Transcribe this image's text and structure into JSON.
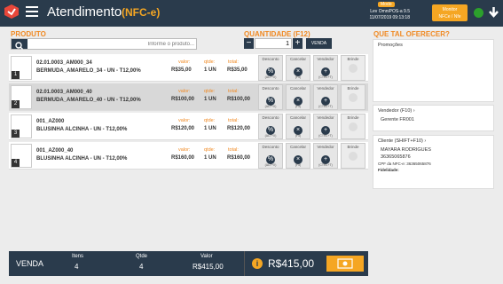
{
  "header": {
    "title": "Atendimento",
    "subtitle": "(NFC-e)",
    "mode_badge": "Modo",
    "device_line1": "Lev OmniPOS-a 9.5",
    "device_line2": "11/07/2019 09:13:18",
    "monitor_label_1": "Monitor",
    "monitor_label_2": "NFCe / Nfe"
  },
  "product": {
    "label": "PRODUTO",
    "placeholder": "Informe o produto..."
  },
  "quantity": {
    "label": "QUANTIDADE (F12)",
    "value": "1",
    "sell_label": "VENDA"
  },
  "suggest_label": "QUE TAL OFERECER?",
  "items": [
    {
      "num": "1",
      "code": "02.01.0003_AM000_34",
      "desc": "BERMUDA_AMARELO_34 - UN - T12,00%",
      "valor": "R$35,00",
      "qtde": "1 UN",
      "total": "R$35,00"
    },
    {
      "num": "2",
      "code": "02.01.0003_AM000_40",
      "desc": "BERMUDA_AMARELO_40 - UN - T12,00%",
      "valor": "R$100,00",
      "qtde": "1 UN",
      "total": "R$100,00"
    },
    {
      "num": "3",
      "code": "001_AZ000",
      "desc": "BLUSINHA ALCINHA - UN - T12,00%",
      "valor": "R$120,00",
      "qtde": "1 UN",
      "total": "R$120,00"
    },
    {
      "num": "4",
      "code": "001_AZ000_40",
      "desc": "BLUSINHA ALCINHA - UN - T12,00%",
      "valor": "R$160,00",
      "qtde": "1 UN",
      "total": "R$160,00"
    }
  ],
  "item_labels": {
    "valor": "valor:",
    "qtde": "qtde:",
    "total": "total:"
  },
  "actions": {
    "desconto": "Desconto",
    "desconto_key": "(ALT+X)",
    "cancelar": "Cancelar",
    "cancelar_key": "(F5)",
    "vendedor": "Vendedor",
    "vendedor_key": "(CTRL+T)",
    "brinde": "Brinde"
  },
  "panels": {
    "promocoes": "Promoções",
    "vendedor_title": "Vendedor (F10)",
    "vendedor_value": "Gerente FR001",
    "cliente_title": "Cliente (SHIFT+F10)",
    "cliente_name": "MAYARA RODRIGUES",
    "cliente_doc": "36365065876",
    "cpf_label": "CPF da NFC-e: 36365065876",
    "fidelidade": "Fidelidade:"
  },
  "footer": {
    "venda": "VENDA",
    "itens_label": "Itens",
    "itens_value": "4",
    "qtde_label": "Qtde",
    "qtde_value": "4",
    "valor_label": "Valor",
    "valor_value": "R$415,00",
    "total": "R$415,00"
  }
}
